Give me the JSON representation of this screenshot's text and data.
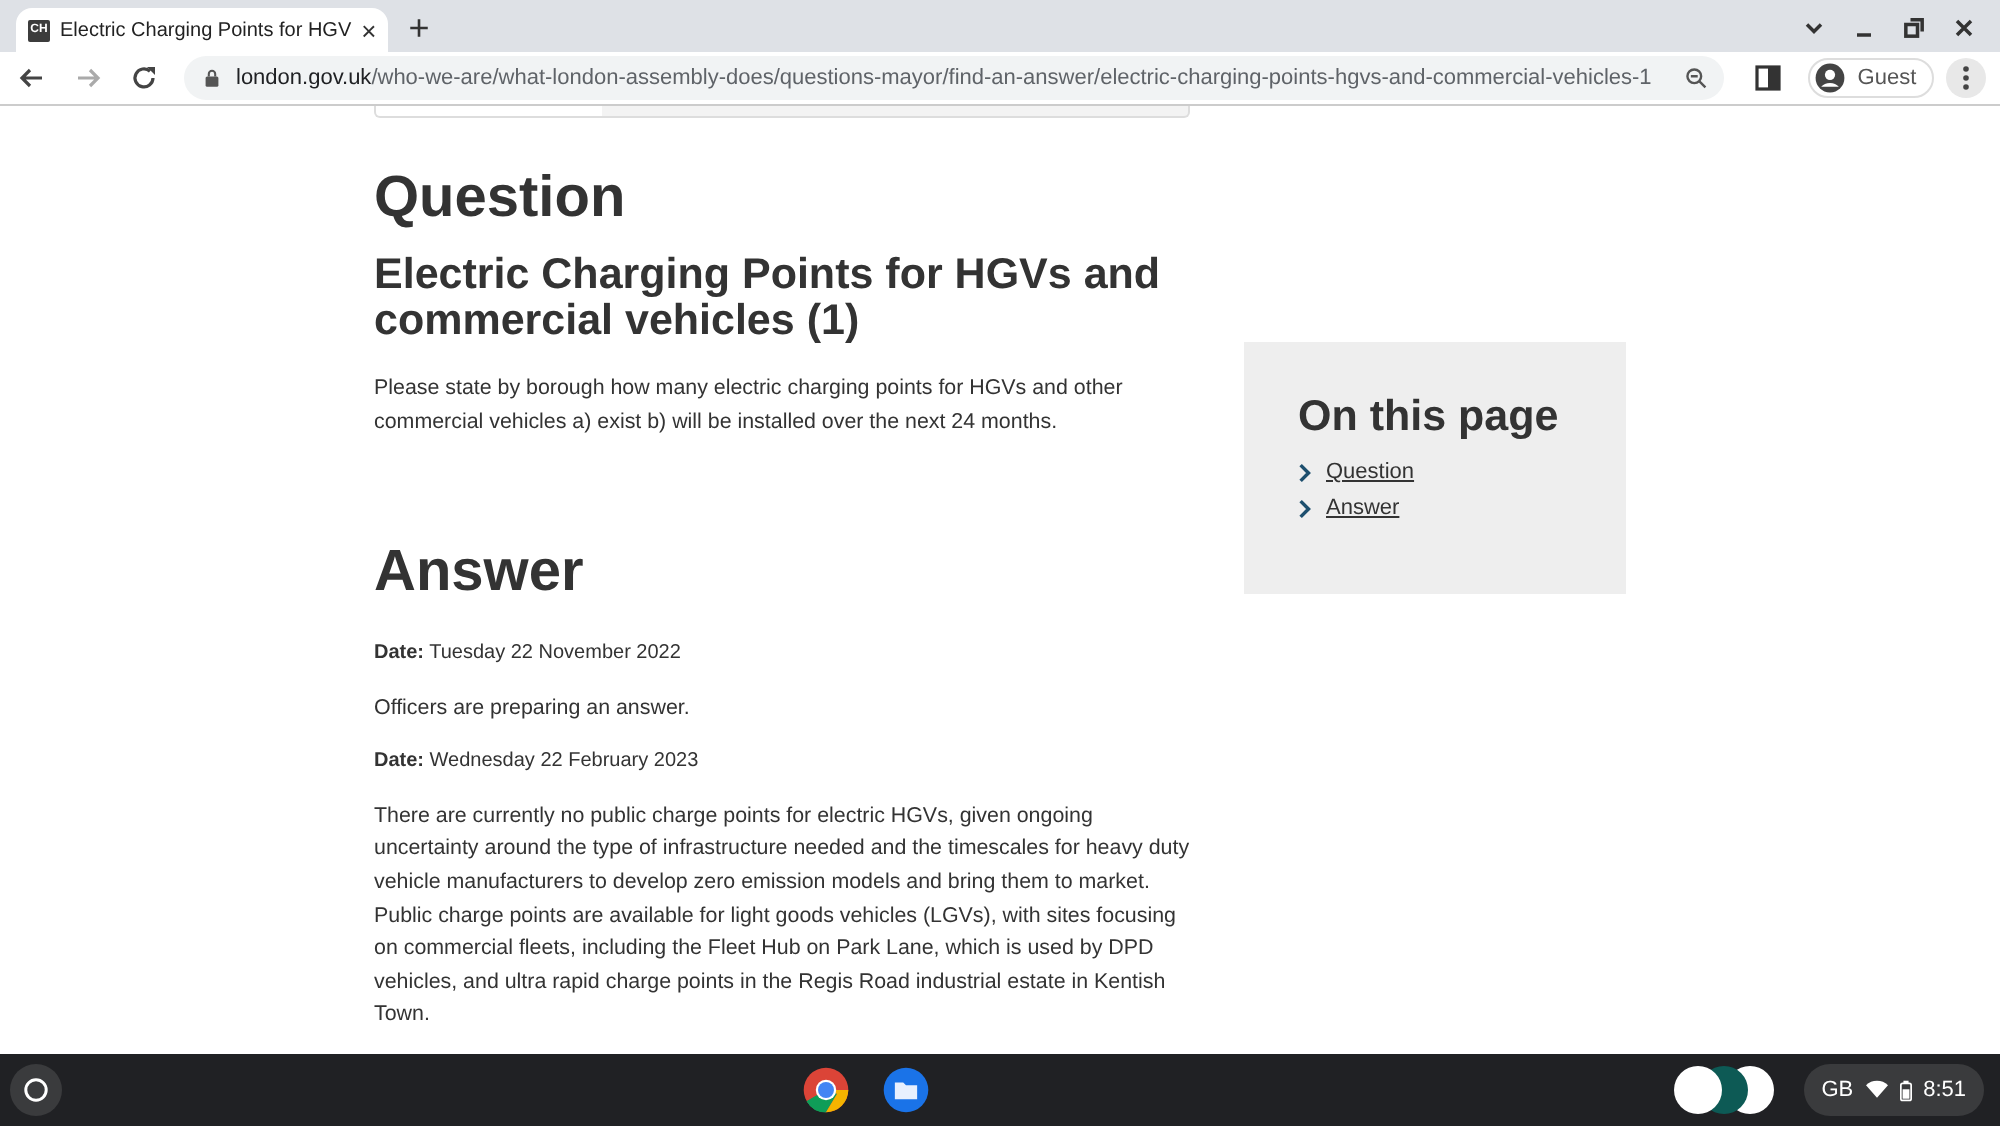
{
  "browser": {
    "tab": {
      "favicon": "CH",
      "title": "Electric Charging Points for HGV",
      "close": "×"
    },
    "new_tab": "+",
    "url": {
      "domain": "london.gov.uk",
      "path": "/who-we-are/what-london-assembly-does/questions-mayor/find-an-answer/electric-charging-points-hgvs-and-commercial-vehicles-1"
    },
    "profile": "Guest"
  },
  "question": {
    "heading": "Question",
    "title": "Electric Charging Points for HGVs and commercial vehicles (1)",
    "text": "Please state by borough how many electric charging points for HGVs and other commercial vehicles a) exist b) will be installed over the next 24 months."
  },
  "answer": {
    "heading": "Answer",
    "entries": [
      {
        "date_label": "Date:",
        "date": "Tuesday 22 November 2022",
        "paragraphs": [
          "Officers are preparing an answer."
        ]
      },
      {
        "date_label": "Date:",
        "date": "Wednesday 22 February 2023",
        "paragraphs": [
          "There are currently no public charge points for electric HGVs, given ongoing uncertainty around the type of infrastructure needed and the timescales for heavy duty vehicle manufacturers to develop zero emission models and bring them to market. Public charge points are available for light goods vehicles (LGVs), with sites focusing on commercial fleets, including the Fleet Hub on Park Lane, which is used by DPD vehicles, and ultra rapid charge points in the Regis Road industrial estate in Kentish Town."
        ]
      }
    ]
  },
  "on_this_page": {
    "heading": "On this page",
    "links": [
      "Question",
      "Answer"
    ]
  },
  "shelf": {
    "status": {
      "keyboard": "GB",
      "time": "8:51"
    }
  }
}
